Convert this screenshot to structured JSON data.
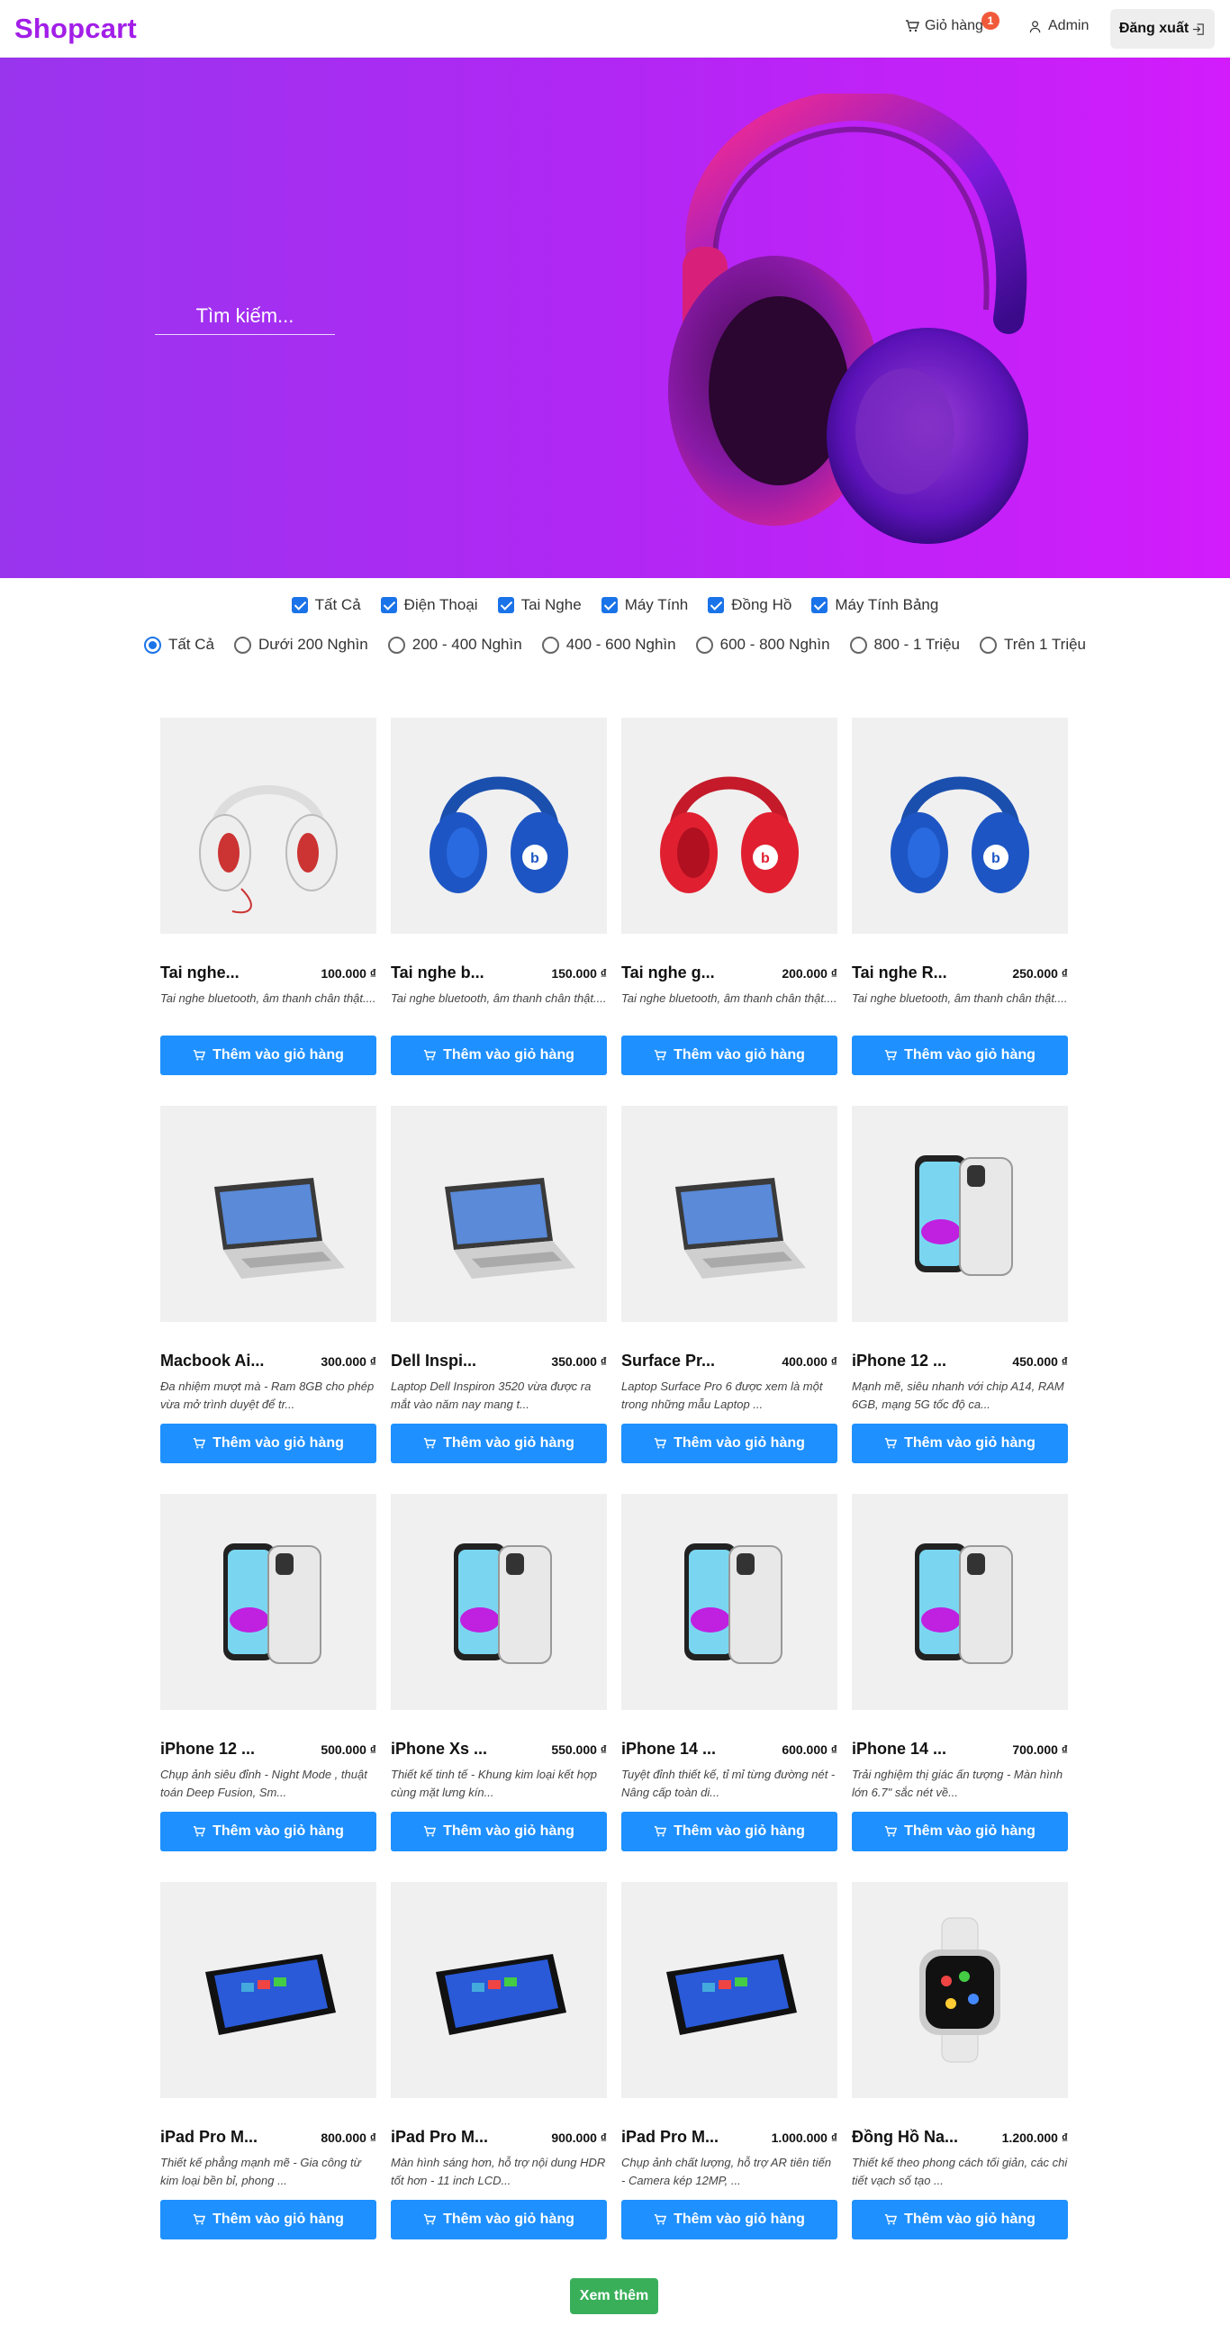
{
  "header": {
    "logo": "Shopcart",
    "cart_label": "Giỏ hàng",
    "cart_count": "1",
    "user_label": "Admin",
    "logout_label": "Đăng xuất"
  },
  "hero": {
    "search_placeholder": "Tìm kiếm..."
  },
  "filters": {
    "categories": [
      "Tất Cả",
      "Điện Thoại",
      "Tai Nghe",
      "Máy Tính",
      "Đồng Hồ",
      "Máy Tính Bảng"
    ],
    "prices": [
      "Tất Cả",
      "Dưới 200 Nghìn",
      "200 - 400 Nghìn",
      "400 - 600 Nghìn",
      "600 - 800 Nghìn",
      "800 - 1 Triệu",
      "Trên 1 Triệu"
    ],
    "selected_price": "Tất Cả"
  },
  "products": [
    {
      "name": "Tai nghe...",
      "price": "100.000 ₫",
      "desc": "Tai nghe bluetooth, âm thanh chân thật....",
      "button": "Thêm vào giỏ hàng",
      "icon": "headphone-white-icon"
    },
    {
      "name": "Tai nghe b...",
      "price": "150.000 ₫",
      "desc": "Tai nghe bluetooth, âm thanh chân thật....",
      "button": "Thêm vào giỏ hàng",
      "icon": "headphone-blue-icon"
    },
    {
      "name": "Tai nghe g...",
      "price": "200.000 ₫",
      "desc": "Tai nghe bluetooth, âm thanh chân thật....",
      "button": "Thêm vào giỏ hàng",
      "icon": "headphone-red-icon"
    },
    {
      "name": "Tai nghe R...",
      "price": "250.000 ₫",
      "desc": "Tai nghe bluetooth, âm thanh chân thật....",
      "button": "Thêm vào giỏ hàng",
      "icon": "headphone-blue-icon"
    },
    {
      "name": "Macbook Ai...",
      "price": "300.000 ₫",
      "desc": "Đa nhiệm mượt mà - Ram 8GB cho phép vừa mở trình duyệt để tr...",
      "button": "Thêm vào giỏ hàng",
      "icon": "laptop-icon"
    },
    {
      "name": "Dell Inspi...",
      "price": "350.000 ₫",
      "desc": "Laptop Dell Inspiron 3520 vừa được ra mắt vào năm nay mang t...",
      "button": "Thêm vào giỏ hàng",
      "icon": "laptop-icon"
    },
    {
      "name": "Surface Pr...",
      "price": "400.000 ₫",
      "desc": "Laptop Surface Pro 6 được xem là một trong những mẫu Laptop ...",
      "button": "Thêm vào giỏ hàng",
      "icon": "laptop-icon"
    },
    {
      "name": "iPhone 12 ...",
      "price": "450.000 ₫",
      "desc": "Mạnh mẽ, siêu nhanh với chip A14, RAM 6GB, mạng 5G tốc độ ca...",
      "button": "Thêm vào giỏ hàng",
      "icon": "phone-icon"
    },
    {
      "name": "iPhone 12 ...",
      "price": "500.000 ₫",
      "desc": "Chụp ảnh siêu đỉnh - Night Mode , thuật toán Deep Fusion, Sm...",
      "button": "Thêm vào giỏ hàng",
      "icon": "phone-icon"
    },
    {
      "name": "iPhone Xs ...",
      "price": "550.000 ₫",
      "desc": "Thiết kế tinh tế - Khung kim loại kết hợp cùng mặt lưng kín...",
      "button": "Thêm vào giỏ hàng",
      "icon": "phone-icon"
    },
    {
      "name": "iPhone 14 ...",
      "price": "600.000 ₫",
      "desc": "Tuyệt đỉnh thiết kế, tỉ mỉ từng đường nét - Nâng cấp toàn di...",
      "button": "Thêm vào giỏ hàng",
      "icon": "phone-icon"
    },
    {
      "name": "iPhone 14 ...",
      "price": "700.000 ₫",
      "desc": "Trải nghiệm thị giác ấn tượng - Màn hình lớn 6.7\" sắc nét về...",
      "button": "Thêm vào giỏ hàng",
      "icon": "phone-icon"
    },
    {
      "name": "iPad Pro M...",
      "price": "800.000 ₫",
      "desc": "Thiết kế phẳng mạnh mẽ - Gia công từ kim loại bền bỉ, phong ...",
      "button": "Thêm vào giỏ hàng",
      "icon": "tablet-icon"
    },
    {
      "name": "iPad Pro M...",
      "price": "900.000 ₫",
      "desc": "Màn hình sáng hơn, hỗ trợ nội dung HDR tốt hơn - 11 inch LCD...",
      "button": "Thêm vào giỏ hàng",
      "icon": "tablet-icon"
    },
    {
      "name": "iPad Pro M...",
      "price": "1.000.000 ₫",
      "desc": "Chụp ảnh chất lượng, hỗ trợ AR tiên tiến - Camera kép 12MP, ...",
      "button": "Thêm vào giỏ hàng",
      "icon": "tablet-icon"
    },
    {
      "name": "Đồng Hồ Na...",
      "price": "1.200.000 ₫",
      "desc": "Thiết kế theo phong cách tối giản, các chi tiết vạch số tạo ...",
      "button": "Thêm vào giỏ hàng",
      "icon": "watch-icon"
    }
  ],
  "more_button": "Xem thêm",
  "colors": {
    "brand": "#a21ee8",
    "primary_button": "#1e90ff",
    "more_button": "#3aaf5a",
    "badge": "#f05a3a"
  }
}
